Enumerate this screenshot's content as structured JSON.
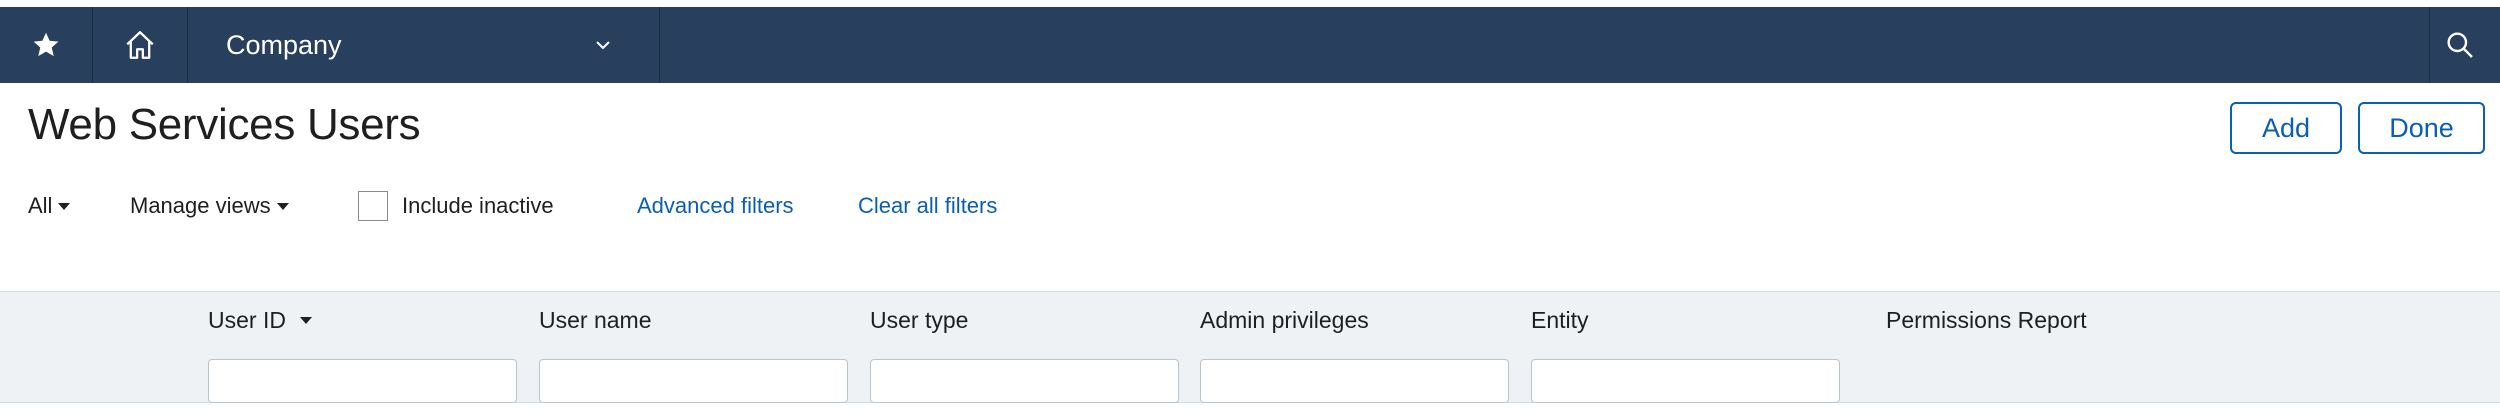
{
  "nav": {
    "company_label": "Company",
    "icons": [
      "star-icon",
      "home-icon",
      "chevron-down-icon",
      "search-icon"
    ],
    "bg_color": "#283f5d"
  },
  "page": {
    "title": "Web Services Users"
  },
  "actions": {
    "add_label": "Add",
    "done_label": "Done",
    "accent_color": "#0a5fb4"
  },
  "filters": {
    "all_label": "All",
    "manage_views_label": "Manage views",
    "include_inactive_label": "Include inactive",
    "include_inactive_checked": false,
    "advanced_filters_label": "Advanced filters",
    "clear_all_label": "Clear all filters"
  },
  "columns": [
    {
      "label": "User ID",
      "sortable": true,
      "filter_value": ""
    },
    {
      "label": "User name",
      "filter_value": ""
    },
    {
      "label": "User type",
      "filter_value": ""
    },
    {
      "label": "Admin privileges",
      "filter_value": ""
    },
    {
      "label": "Entity",
      "filter_value": ""
    },
    {
      "label": "Permissions Report"
    }
  ]
}
